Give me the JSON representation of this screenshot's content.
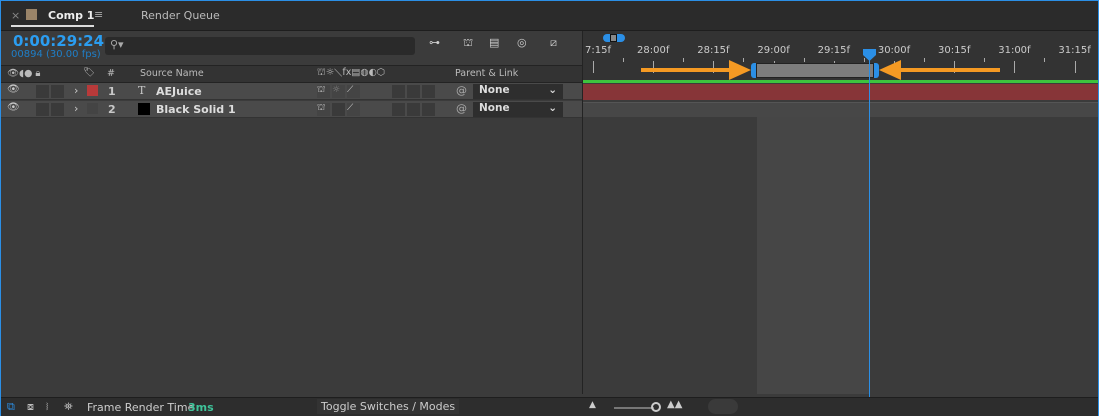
{
  "tabs": [
    {
      "label": "Comp 1",
      "active": true
    },
    {
      "label": "Render Queue",
      "active": false
    }
  ],
  "timecode": "0:00:29:24",
  "frame_info": "00894 (30.00 fps)",
  "search": {
    "placeholder": ""
  },
  "columns": {
    "num": "#",
    "source": "Source Name",
    "parent": "Parent & Link"
  },
  "layers": [
    {
      "num": "1",
      "type_icon": "T",
      "name": "AEJuice",
      "label_color": "#b83a3a",
      "parent": "None",
      "bar_color": "#873538"
    },
    {
      "num": "2",
      "type_icon": "",
      "name": "Black Solid 1",
      "label_color": "#000000",
      "parent": "None",
      "bar_color": "#474747"
    }
  ],
  "ruler": [
    "7:15f",
    "28:00f",
    "28:15f",
    "29:00f",
    "29:15f",
    "30:00f",
    "30:15f",
    "31:00f",
    "31:15f"
  ],
  "footer": {
    "render_label": "Frame Render Time",
    "render_value": "3ms",
    "toggle": "Toggle Switches / Modes"
  },
  "colors": {
    "accent": "#2b8fe6",
    "work_area_arrows": "#f59a23",
    "work_area_bar": "#3ec33e"
  }
}
